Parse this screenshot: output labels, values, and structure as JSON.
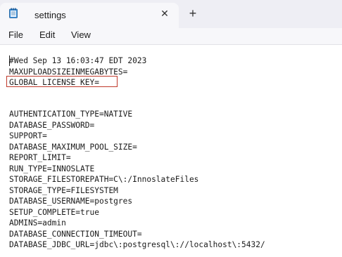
{
  "window": {
    "tab_title": "settings",
    "close_glyph": "✕",
    "new_tab_glyph": "+",
    "app_icon": "notepad-icon"
  },
  "menu": {
    "file": "File",
    "edit": "Edit",
    "view": "View"
  },
  "document": {
    "lines": [
      "#Wed Sep 13 16:03:47 EDT 2023",
      "MAXUPLOADSIZEINMEGABYTES=",
      "GLOBAL_LICENSE_KEY=",
      "AUTHENTICATION_TYPE=NATIVE",
      "DATABASE_PASSWORD=",
      "SUPPORT=",
      "DATABASE_MAXIMUM_POOL_SIZE=",
      "REPORT_LIMIT=",
      "RUN_TYPE=INNOSLATE",
      "STORAGE_FILESTOREPATH=C\\:/InnoslateFiles",
      "STORAGE_TYPE=FILESYSTEM",
      "DATABASE_USERNAME=postgres",
      "SETUP_COMPLETE=true",
      "ADMINS=admin",
      "DATABASE_CONNECTION_TIMEOUT=",
      "DATABASE_JDBC_URL=jdbc\\:postgresql\\://localhost\\:5432/"
    ]
  },
  "colors": {
    "highlight_border": "#c0392b",
    "titlebar": "#eeeef4",
    "tab": "#f7f7fa"
  }
}
